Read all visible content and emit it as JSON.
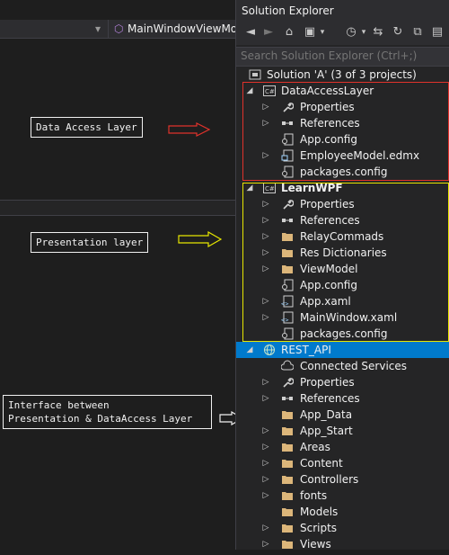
{
  "editor": {
    "nav_left": "",
    "nav_right": "MainWindowViewMod",
    "notes": {
      "data_access": "Data Access Layer",
      "presentation": "Presentation layer",
      "interface_line1": "Interface between",
      "interface_line2": "Presentation & DataAccess Layer"
    },
    "colors": {
      "arrow_red": "#e0322b",
      "arrow_yellow": "#e6e600",
      "arrow_white": "#f1f1f1"
    }
  },
  "solution_explorer": {
    "title": "Solution Explorer",
    "search_placeholder": "Search Solution Explorer (Ctrl+;)",
    "toolbar_icons": [
      "back-icon",
      "forward-icon",
      "home-icon",
      "sync-icon",
      "history-icon",
      "pending-changes-icon",
      "refresh-icon",
      "collapse-icon",
      "show-all-icon"
    ],
    "solution": "Solution 'A' (3 of 3 projects)",
    "projects": [
      {
        "name": "DataAccessLayer",
        "items": [
          {
            "label": "Properties",
            "icon": "wrench-icon",
            "expander": true
          },
          {
            "label": "References",
            "icon": "references-icon",
            "expander": true
          },
          {
            "label": "App.config",
            "icon": "config-icon",
            "expander": false
          },
          {
            "label": "EmployeeModel.edmx",
            "icon": "edmx-icon",
            "expander": true
          },
          {
            "label": "packages.config",
            "icon": "config-icon",
            "expander": false
          }
        ]
      },
      {
        "name": "LearnWPF",
        "items": [
          {
            "label": "Properties",
            "icon": "wrench-icon",
            "expander": true
          },
          {
            "label": "References",
            "icon": "references-icon",
            "expander": true
          },
          {
            "label": "RelayCommads",
            "icon": "folder-icon",
            "expander": true
          },
          {
            "label": "Res Dictionaries",
            "icon": "folder-icon",
            "expander": true
          },
          {
            "label": "ViewModel",
            "icon": "folder-icon",
            "expander": true
          },
          {
            "label": "App.config",
            "icon": "config-icon",
            "expander": false
          },
          {
            "label": "App.xaml",
            "icon": "xaml-icon",
            "expander": true
          },
          {
            "label": "MainWindow.xaml",
            "icon": "xaml-icon",
            "expander": true
          },
          {
            "label": "packages.config",
            "icon": "config-icon",
            "expander": false
          }
        ]
      },
      {
        "name": "REST_API",
        "items": [
          {
            "label": "Connected Services",
            "icon": "cloud-icon",
            "expander": false
          },
          {
            "label": "Properties",
            "icon": "wrench-icon",
            "expander": true
          },
          {
            "label": "References",
            "icon": "references-icon",
            "expander": true
          },
          {
            "label": "App_Data",
            "icon": "folder-icon",
            "expander": false
          },
          {
            "label": "App_Start",
            "icon": "folder-icon",
            "expander": true
          },
          {
            "label": "Areas",
            "icon": "folder-icon",
            "expander": true
          },
          {
            "label": "Content",
            "icon": "folder-icon",
            "expander": true
          },
          {
            "label": "Controllers",
            "icon": "folder-icon",
            "expander": true
          },
          {
            "label": "fonts",
            "icon": "folder-icon",
            "expander": true
          },
          {
            "label": "Models",
            "icon": "folder-icon",
            "expander": false
          },
          {
            "label": "Scripts",
            "icon": "folder-icon",
            "expander": true
          },
          {
            "label": "Views",
            "icon": "folder-icon",
            "expander": true
          }
        ]
      }
    ]
  }
}
